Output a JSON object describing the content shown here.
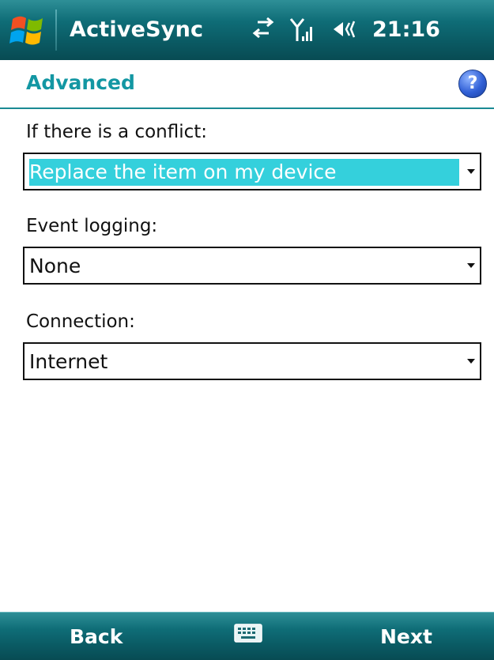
{
  "titlebar": {
    "app_title": "ActiveSync",
    "clock": "21:16",
    "icons": [
      "windows-start-icon",
      "sync-arrows-icon",
      "signal-strength-icon",
      "speaker-volume-icon"
    ]
  },
  "header": {
    "title": "Advanced",
    "help_icon": "help-icon",
    "help_glyph": "?"
  },
  "form": {
    "conflict_label": "If there is a conflict:",
    "conflict_value": "Replace the item on my device",
    "logging_label": "Event logging:",
    "logging_value": "None",
    "connection_label": "Connection:",
    "connection_value": "Internet"
  },
  "softkeys": {
    "left": "Back",
    "right": "Next",
    "center_icon": "keyboard-icon"
  },
  "colors": {
    "titlebar": "#0f6d77",
    "heading_text": "#1397a3",
    "selection": "#34d0dc"
  }
}
